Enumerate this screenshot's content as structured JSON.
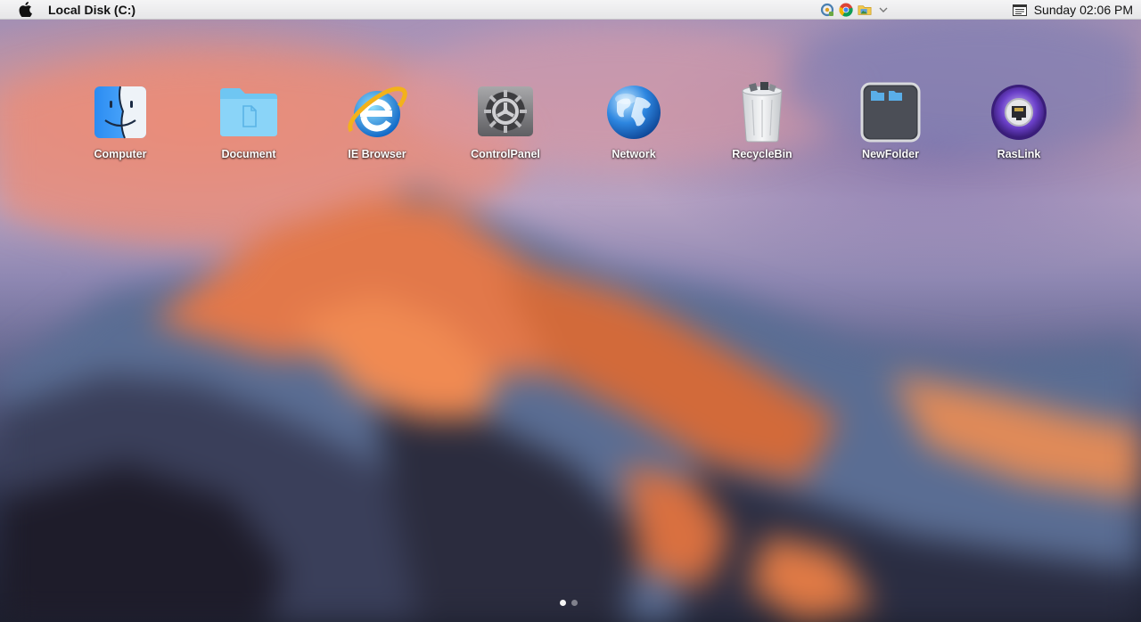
{
  "menubar": {
    "apple_icon": "apple-icon",
    "title": "Local Disk (C:)",
    "tray": [
      {
        "icon": "settings-tray-icon"
      },
      {
        "icon": "chrome-icon"
      },
      {
        "icon": "folder-image-icon"
      },
      {
        "icon": "chevron-down-icon"
      }
    ],
    "notification_icon": "notification-center-icon",
    "clock": "Sunday 02:06 PM"
  },
  "desktop": {
    "icons": [
      {
        "label": "Computer",
        "icon": "finder-icon"
      },
      {
        "label": "Document",
        "icon": "folder-icon"
      },
      {
        "label": "IE Browser",
        "icon": "internet-explorer-icon"
      },
      {
        "label": "ControlPanel",
        "icon": "system-preferences-icon"
      },
      {
        "label": "Network",
        "icon": "globe-icon"
      },
      {
        "label": "RecycleBin",
        "icon": "trash-icon"
      },
      {
        "label": "NewFolder",
        "icon": "folder-stack-icon"
      },
      {
        "label": "RasLink",
        "icon": "network-port-icon"
      }
    ]
  },
  "pagination": {
    "pages": 2,
    "current": 1
  },
  "colors": {
    "menubar": "#ececee",
    "label_text": "#ffffff",
    "accent_blue": "#3a8ee6"
  }
}
